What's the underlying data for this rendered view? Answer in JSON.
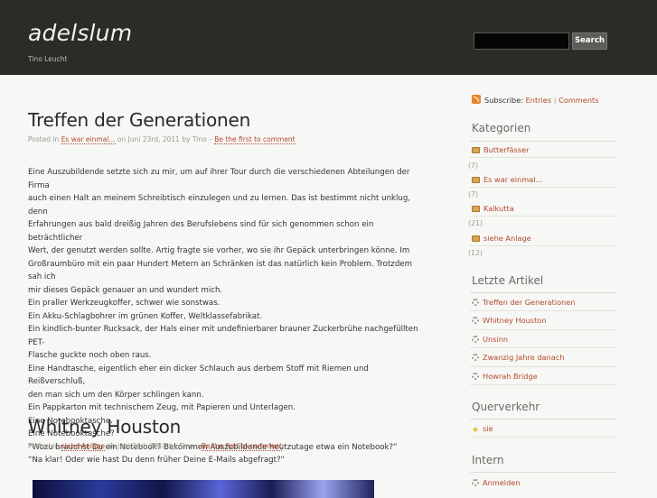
{
  "header": {
    "title": "adelslum",
    "tagline": "Tino Leucht",
    "search_placeholder": "",
    "search_button": "Search"
  },
  "posts": [
    {
      "title": "Treffen der Generationen",
      "meta_prefix": "Posted in",
      "category": "Es war einmal...",
      "meta_middle": "on Juni 23rd, 2011 by Tino –",
      "comment_link": "Be the first to comment",
      "lines": [
        "Eine Auszubildende setzte sich zu mir, um auf ihrer Tour durch die verschiedenen Abteilungen der Firma",
        "auch einen Halt an meinem Schreibtisch einzulegen und zu lernen. Das ist bestimmt nicht unklug, denn",
        "Erfahrungen aus bald dreißig Jahren des Berufslebens sind für sich genommen schon ein beträchtlicher",
        "Wert, der genutzt werden sollte. Artig fragte sie vorher, wo sie ihr Gepäck unterbringen könne. Im",
        "Großraumbüro mit ein paar Hundert Metern an Schränken ist das natürlich kein Problem. Trotzdem sah ich",
        "mir dieses Gepäck genauer an und wundert mich.",
        "Ein praller Werkzeugkoffer, schwer wie sonstwas.",
        "Ein Akku-Schlagbohrer im grünen Koffer, Weltklassefabrikat.",
        "Ein kindlich-bunter Rucksack, der Hals einer mit undefinierbarer brauner Zuckerbrühe nachgefüllten PET-",
        "Flasche guckte noch oben raus.",
        "Eine Handtasche, eigentlich eher ein dicker Schlauch aus derbem Stoff mit Riemen und Reißverschluß,",
        "den man sich um den Körper schlingen kann.",
        "Ein Pappkarton mit technischem Zeug, mit Papieren und Unterlagen.",
        "Eine Notebooktasche.",
        "Eine Notebooktasche?",
        "“Wozu brauchst Du ein Notebook? Bekommen Auszubildende heutzutage etwa ein Notebook?“",
        "“Na klar! Oder wie hast Du denn früher Deine E-Mails abgefragt?“"
      ]
    },
    {
      "title": "Whitney Houston",
      "meta_prefix": "Posted in",
      "category": "siehe Anlage",
      "meta_middle": "on Juni 2nd, 2010 by Tino –",
      "comment_link": "Be the first to comment"
    }
  ],
  "sidebar": {
    "subscribe_label": "Subscribe:",
    "entries_link": "Entries",
    "separator": "|",
    "comments_link": "Comments",
    "kategorien_title": "Kategorien",
    "kategorien": [
      {
        "label": "Butterfässer",
        "count": "(7)"
      },
      {
        "label": "Es war einmal...",
        "count": "(7)"
      },
      {
        "label": "Kalkutta",
        "count": "(21)"
      },
      {
        "label": "siehe Anlage",
        "count": "(12)"
      }
    ],
    "artikel_title": "Letzte Artikel",
    "artikel": [
      "Treffen der Generationen",
      "Whitney Houston",
      "Unsinn",
      "Zwanzig Jahre danach",
      "Howrah Bridge"
    ],
    "querverkehr_title": "Querverkehr",
    "querverkehr": [
      "sie"
    ],
    "intern_title": "Intern",
    "intern": [
      "Anmelden"
    ]
  },
  "colors": {
    "accent": "#b24a2e",
    "header_bg": "#2b2b27",
    "page_bg": "#f7f7f5"
  }
}
